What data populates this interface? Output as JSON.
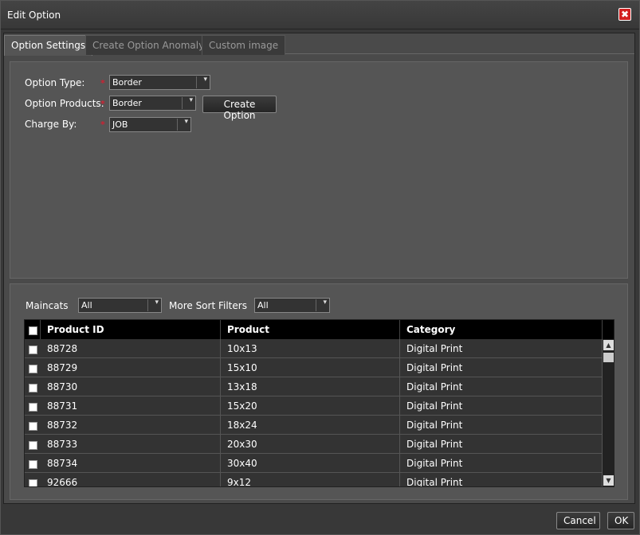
{
  "dialog": {
    "title": "Edit Option",
    "close_icon": "✖"
  },
  "tabs": [
    {
      "label": "Option Settings",
      "active": true
    },
    {
      "label": "Create Option Anomaly",
      "active": false
    },
    {
      "label": "Custom image",
      "active": false
    }
  ],
  "settings": {
    "option_type_label": "Option Type:",
    "option_type_value": "Border",
    "option_products_label": "Option Products:",
    "option_products_value": "Border",
    "create_option_button": "Create Option",
    "charge_by_label": "Charge By:",
    "charge_by_value": "JOB",
    "required_marker": "*"
  },
  "filters": {
    "maincats_label": "Maincats",
    "maincats_value": "All",
    "more_sort_label": "More Sort Filters",
    "more_sort_value": "All"
  },
  "table": {
    "columns": [
      "Product ID",
      "Product",
      "Category"
    ],
    "rows": [
      [
        "88728",
        "10x13",
        "Digital Print"
      ],
      [
        "88729",
        "15x10",
        "Digital Print"
      ],
      [
        "88730",
        "13x18",
        "Digital Print"
      ],
      [
        "88731",
        "15x20",
        "Digital Print"
      ],
      [
        "88732",
        "18x24",
        "Digital Print"
      ],
      [
        "88733",
        "20x30",
        "Digital Print"
      ],
      [
        "88734",
        "30x40",
        "Digital Print"
      ],
      [
        "92666",
        "9x12",
        "Digital Print"
      ]
    ]
  },
  "footer": {
    "cancel_label": "Cancel",
    "ok_label": "OK"
  },
  "icons": {
    "dropdown": "chevron-down-icon",
    "close": "close-icon"
  }
}
